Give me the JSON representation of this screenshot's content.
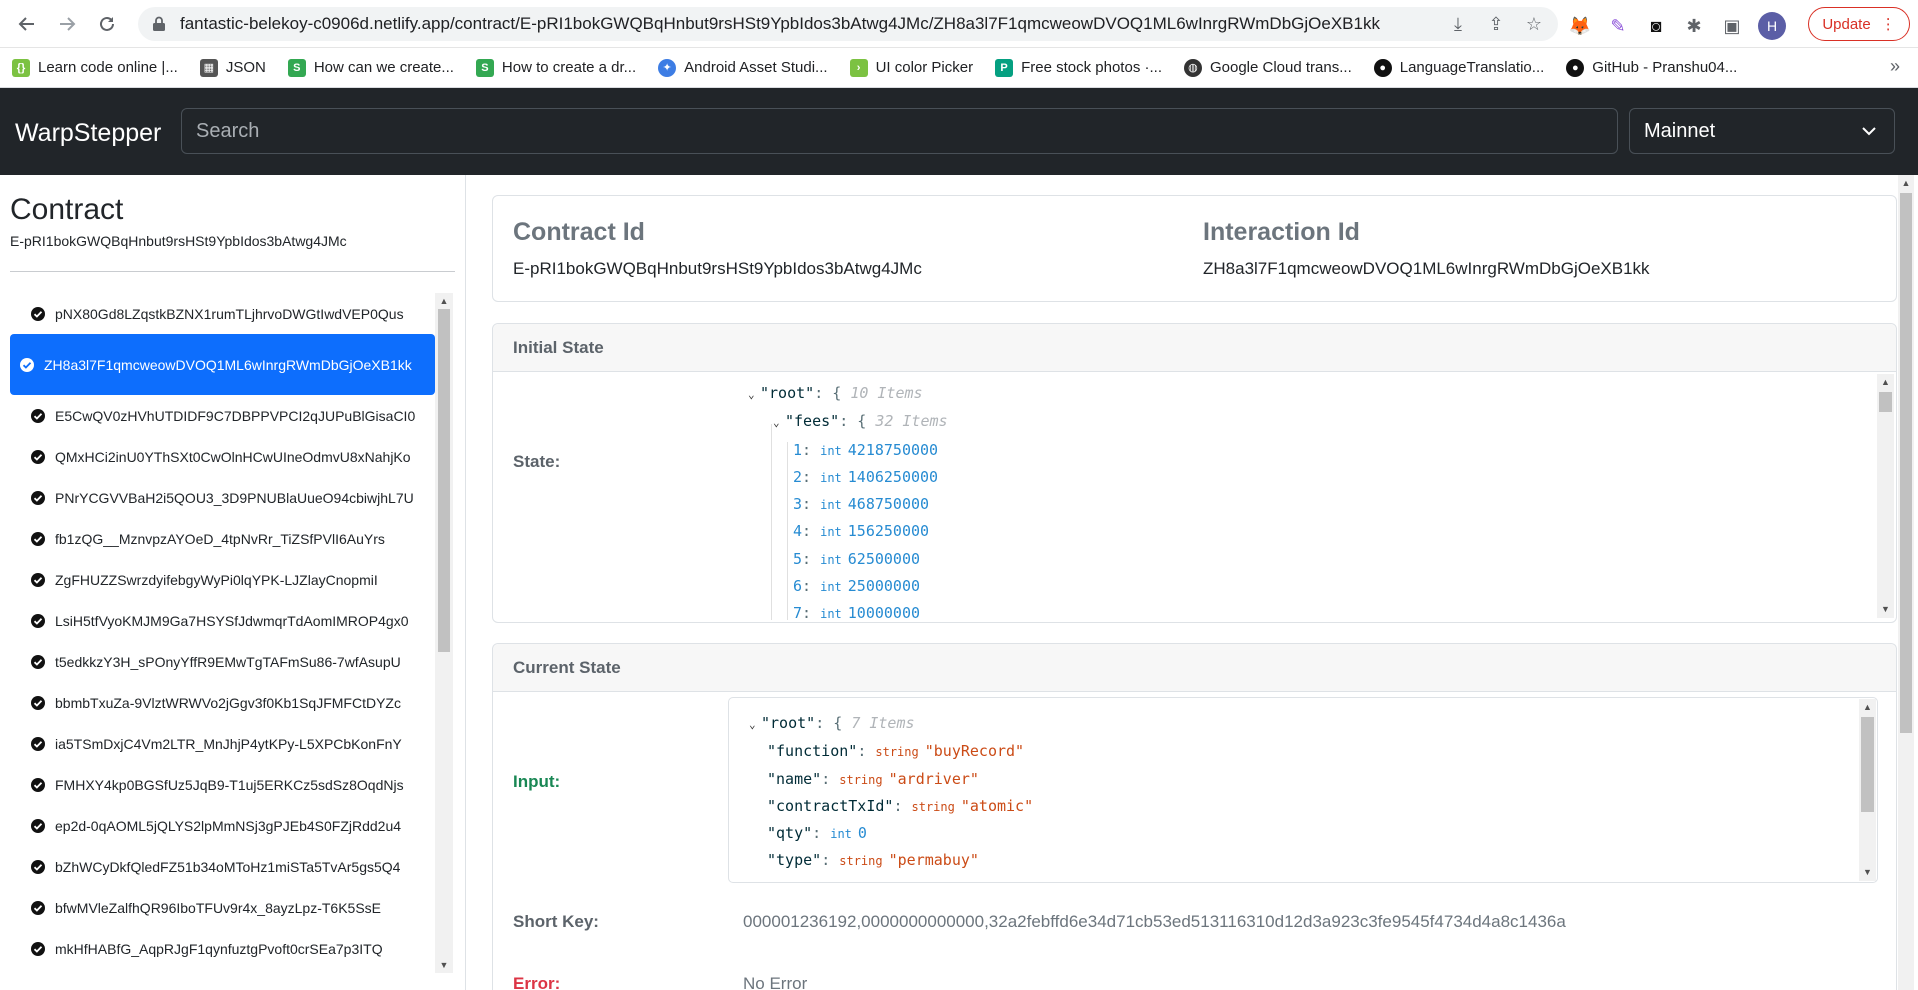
{
  "browser": {
    "url": "fantastic-belekoy-c0906d.netlify.app/contract/E-pRI1bokGWQBqHnbut9rsHSt9YpbIdos3bAtwg4JMc/ZH8a3l7F1qmcweowDVOQ1ML6wInrgRWmDbGjOeXB1kk",
    "profile_initial": "H",
    "update_label": "Update",
    "bookmarks": [
      {
        "label": "Learn code online |...",
        "icon": "code-icon",
        "color": "#7cc242"
      },
      {
        "label": "JSON",
        "icon": "table-icon",
        "color": "#555555"
      },
      {
        "label": "How can we create...",
        "icon": "leaf-icon",
        "color": "#33a852"
      },
      {
        "label": "How to create a dr...",
        "icon": "leaf-icon",
        "color": "#33a852"
      },
      {
        "label": "Android Asset Studi...",
        "icon": "wand-icon",
        "color": "#3d7de4"
      },
      {
        "label": "UI color Picker",
        "icon": "code-icon",
        "color": "#7cc242"
      },
      {
        "label": "Free stock photos ·...",
        "icon": "photo-icon",
        "color": "#05a081"
      },
      {
        "label": "Google Cloud trans...",
        "icon": "globe-icon",
        "color": "#333333"
      },
      {
        "label": "LanguageTranslatio...",
        "icon": "github-icon",
        "color": "#111111"
      },
      {
        "label": "GitHub - Pranshu04...",
        "icon": "github-icon",
        "color": "#111111"
      }
    ]
  },
  "navbar": {
    "brand": "WarpStepper",
    "search_placeholder": "Search",
    "network": "Mainnet"
  },
  "sidebar": {
    "title": "Contract",
    "contract_id": "E-pRI1bokGWQBqHnbut9rsHSt9YpbIdos3bAtwg4JMc",
    "items": [
      "pNX80Gd8LZqstkBZNX1rumTLjhrvoDWGtIwdVEP0Qus",
      "ZH8a3l7F1qmcweowDVOQ1ML6wInrgRWmDbGjOeXB1kk",
      "E5CwQV0zHVhUTDIDF9C7DBPPVPCI2qJUPuBlGisaCI0",
      "QMxHCi2inU0YThSXt0CwOlnHCwUIneOdmvU8xNahjKo",
      "PNrYCGVVBaH2i5QOU3_3D9PNUBlaUueO94cbiwjhL7U",
      "fb1zQG__MznvpzAYOeD_4tpNvRr_TiZSfPVlI6AuYrs",
      "ZgFHUZZSwrzdyifebgyWyPi0lqYPK-LJZlayCnopmiI",
      "LsiH5tfVyoKMJM9Ga7HSYSfJdwmqrTdAomIMROP4gx0",
      "t5edkkzY3H_sPOnyYffR9EMwTgTAFmSu86-7wfAsupU",
      "bbmbTxuZa-9VlztWRWVo2jGgv3f0Kb1SqJFMFCtDYZc",
      "ia5TSmDxjC4Vm2LTR_MnJhjP4ytKPy-L5XPCbKonFnY",
      "FMHXY4kp0BGSfUz5JqB9-T1uj5ERKCz5sdSz8OqdNjs",
      "ep2d-0qAOML5jQLYS2lpMmNSj3gPJEb4S0FZjRdd2u4",
      "bZhWCyDkfQledFZ51b34oMToHz1miSTa5TvAr5gs5Q4",
      "bfwMVleZalfhQR96IboTFUv9r4x_8ayzLpz-T6K5SsE",
      "mkHfHABfG_AqpRJgF1qynfuztgPvoft0crSEa7p3ITQ"
    ],
    "active_index": 1
  },
  "ids": {
    "contract_label": "Contract Id",
    "contract_value": "E-pRI1bokGWQBqHnbut9rsHSt9YpbIdos3bAtwg4JMc",
    "interaction_label": "Interaction Id",
    "interaction_value": "ZH8a3l7F1qmcweowDVOQ1ML6wInrgRWmDbGjOeXB1kk"
  },
  "initial_state": {
    "header": "Initial State",
    "state_label": "State:",
    "root_key": "\"root\"",
    "root_count": "10 Items",
    "fees_key": "\"fees\"",
    "fees_count": "32 Items",
    "type_label": "int",
    "fees": [
      {
        "index": "1",
        "value": "4218750000"
      },
      {
        "index": "2",
        "value": "1406250000"
      },
      {
        "index": "3",
        "value": "468750000"
      },
      {
        "index": "4",
        "value": "156250000"
      },
      {
        "index": "5",
        "value": "62500000"
      },
      {
        "index": "6",
        "value": "25000000"
      },
      {
        "index": "7",
        "value": "10000000"
      }
    ]
  },
  "current_state": {
    "header": "Current State",
    "input_label": "Input:",
    "root_key": "\"root\"",
    "root_count": "7 Items",
    "fields": [
      {
        "key": "\"function\"",
        "type": "string",
        "value": "\"buyRecord\""
      },
      {
        "key": "\"name\"",
        "type": "string",
        "value": "\"ardriver\""
      },
      {
        "key": "\"contractTxId\"",
        "type": "string",
        "value": "\"atomic\""
      },
      {
        "key": "\"qty\"",
        "type": "int",
        "value": "0"
      },
      {
        "key": "\"type\"",
        "type": "string",
        "value": "\"permabuy\""
      }
    ],
    "short_key_label": "Short Key:",
    "short_key_value": "000001236192,0000000000000,32a2febffd6e34d71cb53ed513116310d12d3a923c3fe9545f4734d4a8c1436a",
    "error_label": "Error:",
    "error_value": "No Error"
  }
}
